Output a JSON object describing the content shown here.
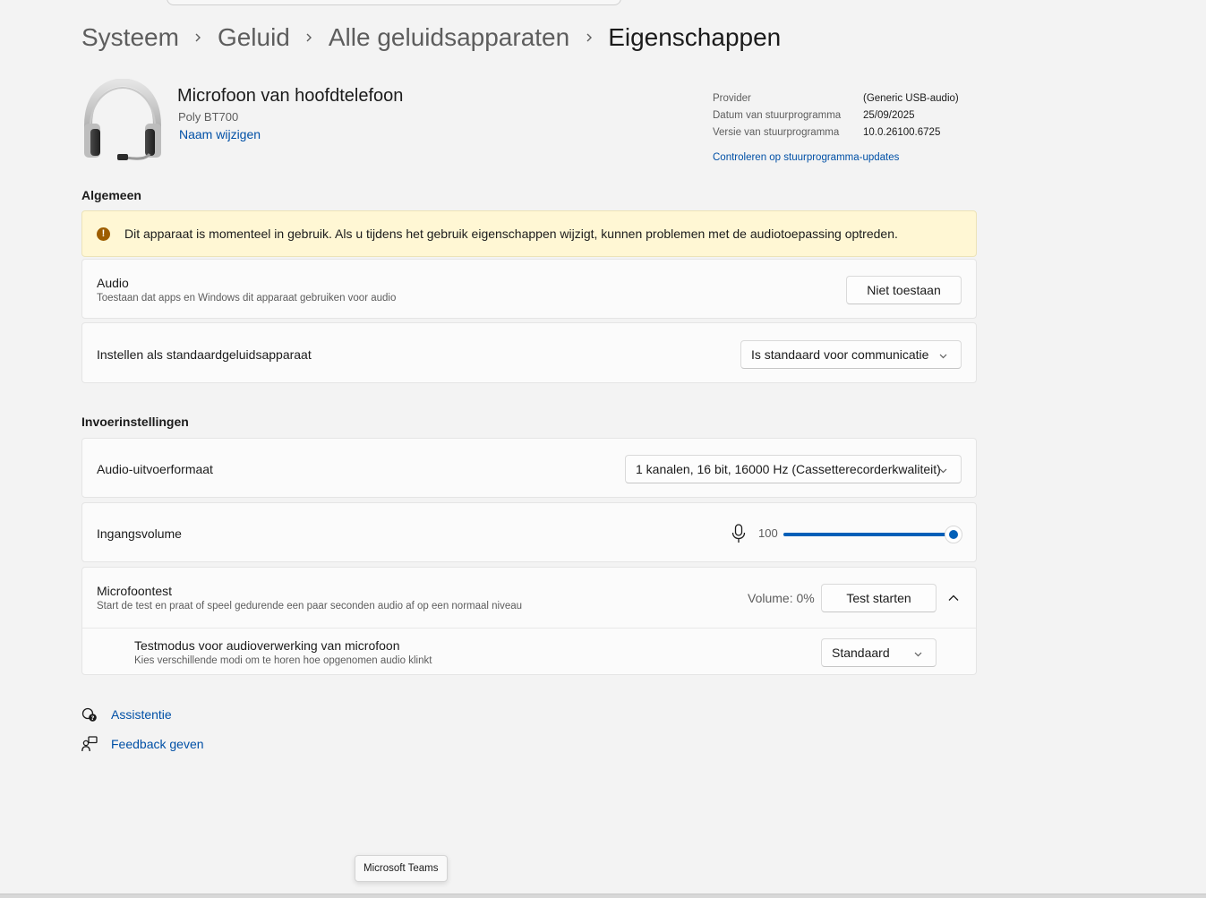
{
  "breadcrumb": {
    "items": [
      "Systeem",
      "Geluid",
      "Alle geluidsapparaten"
    ],
    "current": "Eigenschappen"
  },
  "device": {
    "name": "Microfoon van hoofdtelefoon",
    "model": "Poly BT700",
    "rename_link": "Naam wijzigen",
    "driver": {
      "provider_label": "Provider",
      "provider_value": "(Generic USB-audio)",
      "date_label": "Datum van stuurprogramma",
      "date_value": "25/09/2025",
      "version_label": "Versie van stuurprogramma",
      "version_value": "10.0.26100.6725",
      "check_updates_link": "Controleren op stuurprogramma-updates"
    }
  },
  "general": {
    "heading": "Algemeen",
    "warning": "Dit apparaat is momenteel in gebruik. Als u tijdens het gebruik eigenschappen wijzigt, kunnen problemen met de audiotoepassing optreden.",
    "audio_title": "Audio",
    "audio_desc": "Toestaan dat apps en Windows dit apparaat gebruiken voor audio",
    "audio_button": "Niet toestaan",
    "default_title": "Instellen als standaardgeluidsapparaat",
    "default_value": "Is standaard voor communicatie"
  },
  "input": {
    "heading": "Invoerinstellingen",
    "format_title": "Audio-uitvoerformaat",
    "format_value": "1 kanalen, 16 bit, 16000 Hz (Cassetterecorderkwaliteit)",
    "volume_title": "Ingangsvolume",
    "volume_value": "100",
    "volume_level": 1.0,
    "mictest_title": "Microfoontest",
    "mictest_desc": "Start de test en praat of speel gedurende een paar seconden audio af op een normaal niveau",
    "mictest_volume": "Volume: 0%",
    "mictest_button": "Test starten",
    "testmode_title": "Testmodus voor audioverwerking van microfoon",
    "testmode_desc": "Kies verschillende modi om te horen hoe opgenomen audio klinkt",
    "testmode_value": "Standaard"
  },
  "footer": {
    "help_link": "Assistentie",
    "feedback_link": "Feedback geven"
  },
  "tooltip": "Microsoft Teams",
  "colors": {
    "accent": "#005fb8",
    "link": "#0050a6",
    "warning_bg": "#fff7d4",
    "warning_icon": "#9d5d00",
    "background": "#f3f3f3"
  }
}
